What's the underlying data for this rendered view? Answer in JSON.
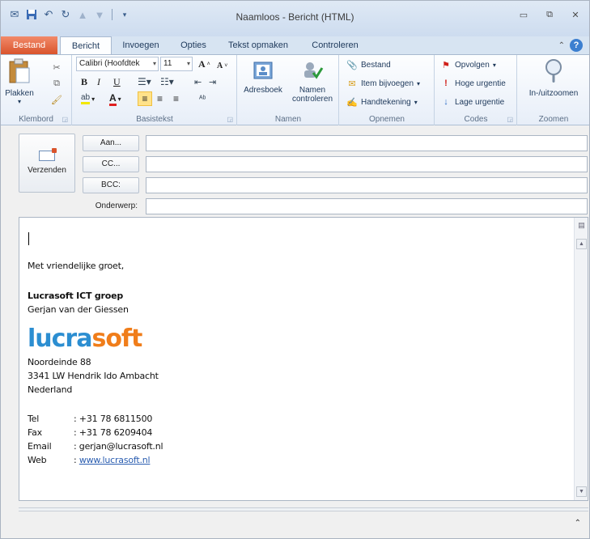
{
  "window": {
    "title": "Naamloos - Bericht (HTML)",
    "minimize": "▭",
    "restore": "⧉",
    "close": "✕"
  },
  "qat": {
    "icons": [
      "envelope-icon",
      "save-icon",
      "undo-icon",
      "redo-icon",
      "up-arrow-icon",
      "down-arrow-icon",
      "customize-icon"
    ]
  },
  "tabs": {
    "file": "Bestand",
    "items": [
      "Bericht",
      "Invoegen",
      "Opties",
      "Tekst opmaken",
      "Controleren"
    ],
    "active": "Bericht"
  },
  "ribbon": {
    "clipboard": {
      "label": "Klembord",
      "paste": "Plakken"
    },
    "basictext": {
      "label": "Basistekst",
      "font": "Calibri (Hoofdtek",
      "size": "11"
    },
    "names": {
      "label": "Namen",
      "addressbook": "Adresboek",
      "checknames_1": "Namen",
      "checknames_2": "controleren"
    },
    "include": {
      "label": "Opnemen",
      "file": "Bestand",
      "item": "Item bijvoegen",
      "signature": "Handtekening"
    },
    "tags": {
      "label": "Codes",
      "followup": "Opvolgen",
      "high": "Hoge urgentie",
      "low": "Lage urgentie"
    },
    "zoom": {
      "label": "Zoomen",
      "zoom": "In-/uitzoomen"
    }
  },
  "header": {
    "send": "Verzenden",
    "to": "Aan...",
    "cc": "CC...",
    "bcc": "BCC:",
    "subject": "Onderwerp:",
    "to_value": "",
    "cc_value": "",
    "bcc_value": "",
    "subject_value": ""
  },
  "body": {
    "greeting": "Met vriendelijke groet,",
    "company": "Lucrasoft ICT groep",
    "person": "Gerjan van der Giessen",
    "logo_part1": "lucra",
    "logo_part2": "soft",
    "address1": "Noordeinde 88",
    "address2": "3341 LW Hendrik Ido Ambacht",
    "address3": "Nederland",
    "contact": [
      {
        "key": "Tel",
        "value": ": +31 78 6811500"
      },
      {
        "key": "Fax",
        "value": ": +31 78 6209404"
      },
      {
        "key": "Email",
        "value": ": gerjan@lucrasoft.nl"
      },
      {
        "key": "Web",
        "value": ": "
      }
    ],
    "web_link": "www.lucrasoft.nl"
  },
  "colors": {
    "file_tab": "#d9542c",
    "logo_blue": "#2c8ed1",
    "logo_orange": "#f07d1a",
    "link": "#2a5db0"
  }
}
